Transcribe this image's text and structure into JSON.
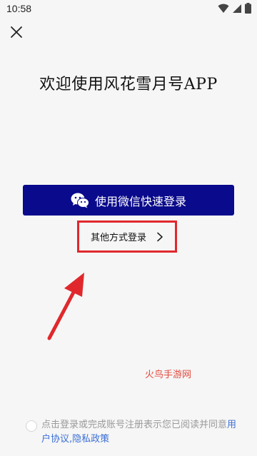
{
  "status_bar": {
    "time": "10:58",
    "icons": [
      "wifi-icon",
      "signal-icon",
      "battery-icon"
    ]
  },
  "header": {
    "close_icon": "close-icon"
  },
  "main": {
    "title": "欢迎使用风花雪月号APP",
    "wechat_button_label": "使用微信快速登录",
    "other_login_label": "其他方式登录"
  },
  "watermark": "火鸟手游网",
  "agreement": {
    "text_prefix": "点击登录或完成账号注册表示您已阅读并同意",
    "user_agreement": "用户协议",
    "separator": ",",
    "privacy_policy": "隐私政策"
  },
  "colors": {
    "primary_button": "#0a0a8c",
    "annotation_red": "#e0282c",
    "link_blue": "#3b6fd6",
    "watermark": "#e24a3e",
    "background": "#f6f6f6"
  }
}
